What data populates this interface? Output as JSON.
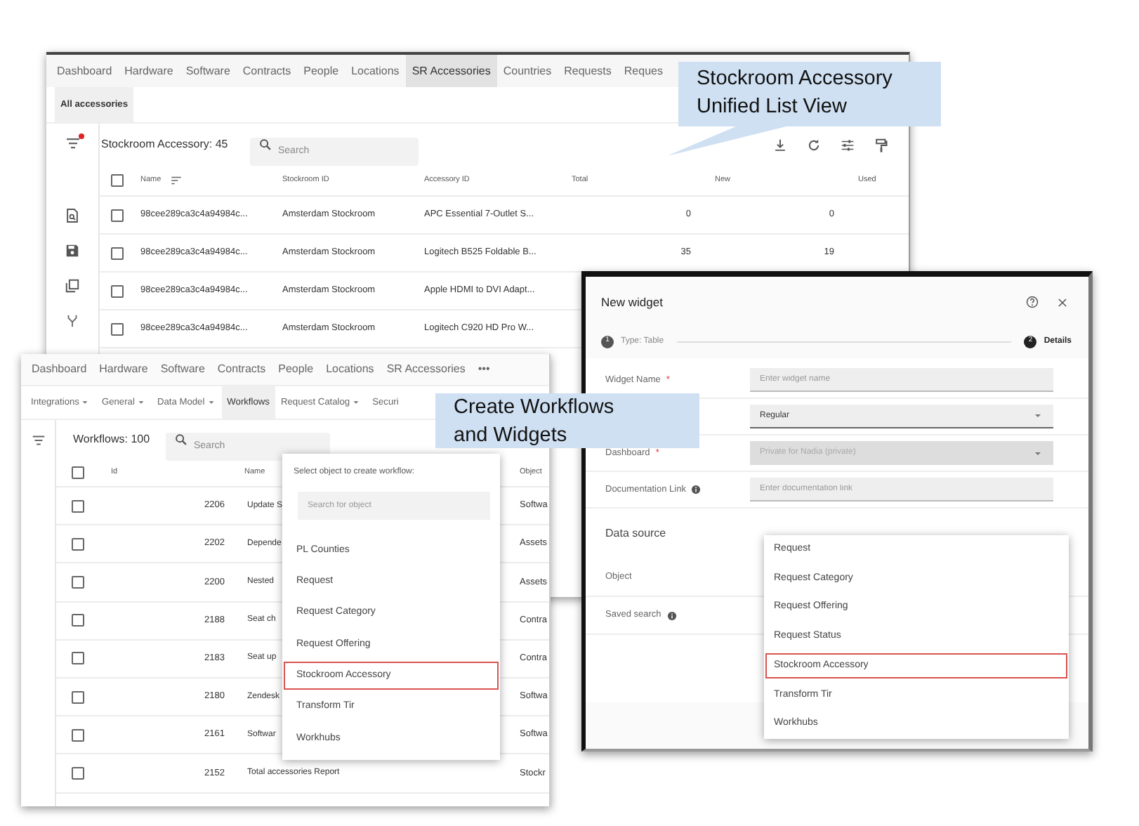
{
  "accessories_window": {
    "tabs": [
      {
        "label": "Dashboard",
        "selected": false
      },
      {
        "label": "Hardware",
        "selected": false
      },
      {
        "label": "Software",
        "selected": false
      },
      {
        "label": "Contracts",
        "selected": false
      },
      {
        "label": "People",
        "selected": false
      },
      {
        "label": "Locations",
        "selected": false
      },
      {
        "label": "SR Accessories",
        "selected": true
      },
      {
        "label": "Countries",
        "selected": false
      },
      {
        "label": "Requests",
        "selected": false
      },
      {
        "label": "Reques",
        "selected": false
      }
    ],
    "subtabs": [
      {
        "label": "All accessories",
        "selected": true
      }
    ],
    "filter_active": true,
    "select_all_checked": false,
    "count_label": "Stockroom Accessory: 45",
    "search_placeholder": "Search",
    "columns": [
      "Name",
      "Stockroom ID",
      "Accessory ID",
      "Total",
      "New",
      "Used"
    ],
    "rows": [
      {
        "checked": false,
        "cells": [
          "98cee289ca3c4a94984c...",
          "Amsterdam Stockroom",
          "APC Essential 7-Outlet S...",
          "0",
          "0"
        ]
      },
      {
        "checked": false,
        "cells": [
          "98cee289ca3c4a94984c...",
          "Amsterdam Stockroom",
          "Logitech B525 Foldable B...",
          "35",
          "19"
        ]
      },
      {
        "checked": false,
        "cells": [
          "98cee289ca3c4a94984c...",
          "Amsterdam Stockroom",
          "Apple HDMI to DVI Adapt..."
        ]
      },
      {
        "checked": false,
        "cells": [
          "98cee289ca3c4a94984c...",
          "Amsterdam Stockroom",
          "Logitech C920 HD Pro W..."
        ]
      }
    ]
  },
  "workflows_window": {
    "tabs": [
      {
        "label": "Dashboard",
        "selected": false
      },
      {
        "label": "Hardware",
        "selected": false
      },
      {
        "label": "Software",
        "selected": false
      },
      {
        "label": "Contracts",
        "selected": false
      },
      {
        "label": "People",
        "selected": false
      },
      {
        "label": "Locations",
        "selected": false
      },
      {
        "label": "SR Accessories",
        "selected": false
      },
      {
        "label": "•••",
        "selected": false
      }
    ],
    "subtabs": [
      {
        "label": "Integrations",
        "kind": "dropdown",
        "selected": false
      },
      {
        "label": "General",
        "kind": "dropdown",
        "selected": false
      },
      {
        "label": "Data Model",
        "kind": "dropdown",
        "selected": false
      },
      {
        "label": "Workflows",
        "kind": "link",
        "selected": true
      },
      {
        "label": "Request Catalog",
        "kind": "dropdown",
        "selected": false
      },
      {
        "label": "Securi",
        "kind": "link",
        "selected": false
      }
    ],
    "count_label": "Workflows: 100",
    "select_all_checked": false,
    "search_placeholder": "Search",
    "columns": [
      "Id",
      "Name",
      "Object"
    ],
    "rows": [
      {
        "checked": false,
        "id": "2206",
        "name": "Update S",
        "object": "Softwa"
      },
      {
        "checked": false,
        "id": "2202",
        "name": "Depende",
        "object": "Assets"
      },
      {
        "checked": false,
        "id": "2200",
        "name": "Nested",
        "object": "Assets"
      },
      {
        "checked": false,
        "id": "2188",
        "name": "Seat ch",
        "object": "Contra"
      },
      {
        "checked": false,
        "id": "2183",
        "name": "Seat up",
        "object": "Contra"
      },
      {
        "checked": false,
        "id": "2180",
        "name": "Zendesk",
        "object": "Softwa"
      },
      {
        "checked": false,
        "id": "2161",
        "name": "Softwar",
        "object": "Softwa"
      },
      {
        "checked": false,
        "id": "2152",
        "name": "Total accessories Report",
        "object": "Stockr"
      }
    ],
    "object_menu": {
      "title": "Select object to create workflow:",
      "search_placeholder": "Search for object",
      "items": [
        {
          "label": "PL Counties",
          "highlighted": false
        },
        {
          "label": "Request",
          "highlighted": false
        },
        {
          "label": "Request Category",
          "highlighted": false
        },
        {
          "label": "Request Offering",
          "highlighted": false
        },
        {
          "label": "Stockroom Accessory",
          "highlighted": true
        },
        {
          "label": "Transform Tir",
          "highlighted": false
        },
        {
          "label": "Workhubs",
          "highlighted": false
        }
      ]
    }
  },
  "widget_dialog": {
    "title": "New widget",
    "steps": [
      {
        "number": "1",
        "label": "Type: Table",
        "active": false
      },
      {
        "number": "2",
        "label": "Details",
        "active": true
      }
    ],
    "fields": [
      {
        "kind": "text",
        "label": "Widget Name",
        "required_mark": "*",
        "placeholder": "Enter widget name"
      },
      {
        "kind": "select",
        "value": "Regular",
        "disabled": false
      },
      {
        "kind": "select",
        "label": "Dashboard",
        "required_mark": "*",
        "value": "Private for Nadia (private)",
        "disabled": true
      },
      {
        "kind": "text",
        "label": "Documentation Link",
        "info": true,
        "placeholder": "Enter documentation link"
      }
    ],
    "section_title": "Data source",
    "source_fields": [
      {
        "label": "Object"
      },
      {
        "label": "Saved search",
        "info": true
      }
    ],
    "object_menu": {
      "items": [
        {
          "label": "Request",
          "highlighted": false
        },
        {
          "label": "Request Category",
          "highlighted": false
        },
        {
          "label": "Request Offering",
          "highlighted": false
        },
        {
          "label": "Request Status",
          "highlighted": false
        },
        {
          "label": "Stockroom Accessory",
          "highlighted": true
        },
        {
          "label": "Transform Tir",
          "highlighted": false
        },
        {
          "label": "Workhubs",
          "highlighted": false
        }
      ]
    }
  },
  "callouts": [
    {
      "lines": [
        "Stockroom Accessory",
        "Unified List View"
      ],
      "tail": true
    },
    {
      "lines": [
        "Create Workflows",
        "and Widgets"
      ]
    }
  ]
}
